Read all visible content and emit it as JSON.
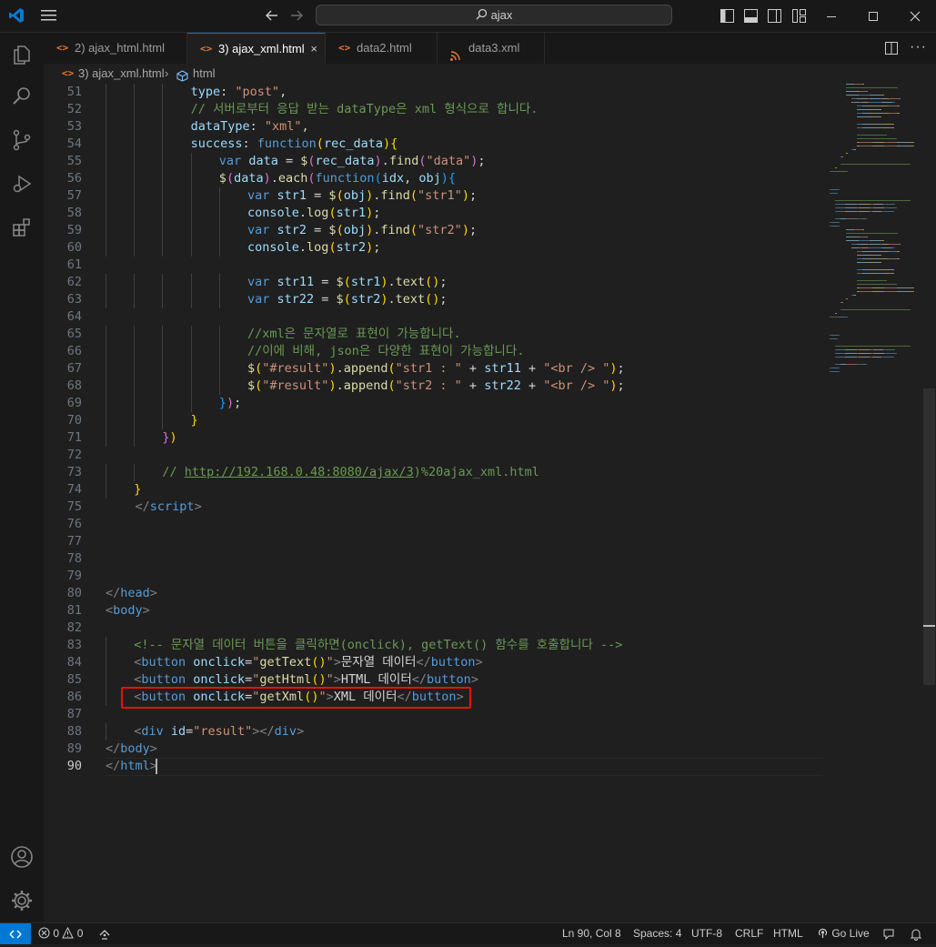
{
  "window": {
    "search": "ajax"
  },
  "tabs": [
    {
      "icon": "<>",
      "label": "2) ajax_html.html",
      "active": false
    },
    {
      "icon": "<>",
      "label": "3) ajax_xml.html",
      "active": true,
      "close": "×"
    },
    {
      "icon": "<>",
      "label": "data2.html",
      "active": false
    },
    {
      "icon": "rss",
      "label": "data3.xml",
      "active": false
    }
  ],
  "breadcrumb": {
    "file": "3) ajax_xml.html",
    "symbol": "html"
  },
  "editor": {
    "current_line": 90,
    "lines": [
      {
        "n": 51,
        "indent": 12,
        "tokens": [
          [
            "v",
            "type"
          ],
          [
            "p",
            ": "
          ],
          [
            "s",
            "\"post\""
          ],
          [
            "p",
            ","
          ]
        ]
      },
      {
        "n": 52,
        "indent": 12,
        "tokens": [
          [
            "c",
            "// 서버로부터 응답 받는 dataType은 xml 형식으로 합니다."
          ]
        ]
      },
      {
        "n": 53,
        "indent": 12,
        "tokens": [
          [
            "v",
            "dataType"
          ],
          [
            "p",
            ": "
          ],
          [
            "s",
            "\"xml\""
          ],
          [
            "p",
            ","
          ]
        ]
      },
      {
        "n": 54,
        "indent": 12,
        "tokens": [
          [
            "v",
            "success"
          ],
          [
            "p",
            ": "
          ],
          [
            "k",
            "function"
          ],
          [
            "y",
            "("
          ],
          [
            "v",
            "rec_data"
          ],
          [
            "y",
            ")"
          ],
          [
            "y",
            "{"
          ]
        ]
      },
      {
        "n": 55,
        "indent": 16,
        "tokens": [
          [
            "k",
            "var "
          ],
          [
            "v",
            "data"
          ],
          [
            "p",
            " = "
          ],
          [
            "f",
            "$"
          ],
          [
            "m",
            "("
          ],
          [
            "v",
            "rec_data"
          ],
          [
            "m",
            ")"
          ],
          [
            "p",
            "."
          ],
          [
            "f",
            "find"
          ],
          [
            "m",
            "("
          ],
          [
            "s",
            "\"data\""
          ],
          [
            "m",
            ")"
          ],
          [
            "p",
            ";"
          ]
        ]
      },
      {
        "n": 56,
        "indent": 16,
        "tokens": [
          [
            "f",
            "$"
          ],
          [
            "m",
            "("
          ],
          [
            "v",
            "data"
          ],
          [
            "m",
            ")"
          ],
          [
            "p",
            "."
          ],
          [
            "f",
            "each"
          ],
          [
            "m",
            "("
          ],
          [
            "k",
            "function"
          ],
          [
            "b",
            "("
          ],
          [
            "v",
            "idx"
          ],
          [
            "p",
            ", "
          ],
          [
            "v",
            "obj"
          ],
          [
            "b",
            ")"
          ],
          [
            "b",
            "{"
          ]
        ]
      },
      {
        "n": 57,
        "indent": 20,
        "tokens": [
          [
            "k",
            "var "
          ],
          [
            "v",
            "str1"
          ],
          [
            "p",
            " = "
          ],
          [
            "f",
            "$"
          ],
          [
            "y",
            "("
          ],
          [
            "v",
            "obj"
          ],
          [
            "y",
            ")"
          ],
          [
            "p",
            "."
          ],
          [
            "f",
            "find"
          ],
          [
            "y",
            "("
          ],
          [
            "s",
            "\"str1\""
          ],
          [
            "y",
            ")"
          ],
          [
            "p",
            ";"
          ]
        ]
      },
      {
        "n": 58,
        "indent": 20,
        "tokens": [
          [
            "v",
            "console"
          ],
          [
            "p",
            "."
          ],
          [
            "f",
            "log"
          ],
          [
            "y",
            "("
          ],
          [
            "v",
            "str1"
          ],
          [
            "y",
            ")"
          ],
          [
            "p",
            ";"
          ]
        ]
      },
      {
        "n": 59,
        "indent": 20,
        "tokens": [
          [
            "k",
            "var "
          ],
          [
            "v",
            "str2"
          ],
          [
            "p",
            " = "
          ],
          [
            "f",
            "$"
          ],
          [
            "y",
            "("
          ],
          [
            "v",
            "obj"
          ],
          [
            "y",
            ")"
          ],
          [
            "p",
            "."
          ],
          [
            "f",
            "find"
          ],
          [
            "y",
            "("
          ],
          [
            "s",
            "\"str2\""
          ],
          [
            "y",
            ")"
          ],
          [
            "p",
            ";"
          ]
        ]
      },
      {
        "n": 60,
        "indent": 20,
        "tokens": [
          [
            "v",
            "console"
          ],
          [
            "p",
            "."
          ],
          [
            "f",
            "log"
          ],
          [
            "y",
            "("
          ],
          [
            "v",
            "str2"
          ],
          [
            "y",
            ")"
          ],
          [
            "p",
            ";"
          ]
        ]
      },
      {
        "n": 61,
        "indent": 0,
        "tokens": []
      },
      {
        "n": 62,
        "indent": 20,
        "tokens": [
          [
            "k",
            "var "
          ],
          [
            "v",
            "str11"
          ],
          [
            "p",
            " = "
          ],
          [
            "f",
            "$"
          ],
          [
            "y",
            "("
          ],
          [
            "v",
            "str1"
          ],
          [
            "y",
            ")"
          ],
          [
            "p",
            "."
          ],
          [
            "f",
            "text"
          ],
          [
            "y",
            "()"
          ],
          [
            "p",
            ";"
          ]
        ]
      },
      {
        "n": 63,
        "indent": 20,
        "tokens": [
          [
            "k",
            "var "
          ],
          [
            "v",
            "str22"
          ],
          [
            "p",
            " = "
          ],
          [
            "f",
            "$"
          ],
          [
            "y",
            "("
          ],
          [
            "v",
            "str2"
          ],
          [
            "y",
            ")"
          ],
          [
            "p",
            "."
          ],
          [
            "f",
            "text"
          ],
          [
            "y",
            "()"
          ],
          [
            "p",
            ";"
          ]
        ]
      },
      {
        "n": 64,
        "indent": 0,
        "tokens": []
      },
      {
        "n": 65,
        "indent": 20,
        "tokens": [
          [
            "c",
            "//xml은 문자열로 표현이 가능합니다."
          ]
        ]
      },
      {
        "n": 66,
        "indent": 20,
        "tokens": [
          [
            "c",
            "//이에 비해, json은 다양한 표현이 가능합니다."
          ]
        ]
      },
      {
        "n": 67,
        "indent": 20,
        "tokens": [
          [
            "f",
            "$"
          ],
          [
            "y",
            "("
          ],
          [
            "s",
            "\"#result\""
          ],
          [
            "y",
            ")"
          ],
          [
            "p",
            "."
          ],
          [
            "f",
            "append"
          ],
          [
            "y",
            "("
          ],
          [
            "s",
            "\"str1 : \""
          ],
          [
            "p",
            " + "
          ],
          [
            "v",
            "str11"
          ],
          [
            "p",
            " + "
          ],
          [
            "s",
            "\"<br /> \""
          ],
          [
            "y",
            ")"
          ],
          [
            "p",
            ";"
          ]
        ]
      },
      {
        "n": 68,
        "indent": 20,
        "tokens": [
          [
            "f",
            "$"
          ],
          [
            "y",
            "("
          ],
          [
            "s",
            "\"#result\""
          ],
          [
            "y",
            ")"
          ],
          [
            "p",
            "."
          ],
          [
            "f",
            "append"
          ],
          [
            "y",
            "("
          ],
          [
            "s",
            "\"str2 : \""
          ],
          [
            "p",
            " + "
          ],
          [
            "v",
            "str22"
          ],
          [
            "p",
            " + "
          ],
          [
            "s",
            "\"<br /> \""
          ],
          [
            "y",
            ")"
          ],
          [
            "p",
            ";"
          ]
        ]
      },
      {
        "n": 69,
        "indent": 16,
        "tokens": [
          [
            "b",
            "}"
          ],
          [
            "m",
            ")"
          ],
          [
            "p",
            ";"
          ]
        ]
      },
      {
        "n": 70,
        "indent": 12,
        "tokens": [
          [
            "y",
            "}"
          ]
        ]
      },
      {
        "n": 71,
        "indent": 8,
        "tokens": [
          [
            "m",
            "}"
          ],
          [
            "y",
            ")"
          ]
        ]
      },
      {
        "n": 72,
        "indent": 0,
        "tokens": []
      },
      {
        "n": 73,
        "indent": 8,
        "tokens": [
          [
            "c",
            "// "
          ],
          [
            "u",
            "http://192.168.0.48:8080/ajax/3"
          ],
          [
            "c",
            ")%20ajax_xml.html"
          ]
        ]
      },
      {
        "n": 74,
        "indent": 4,
        "tokens": [
          [
            "y",
            "}"
          ]
        ]
      },
      {
        "n": 75,
        "indent": 0,
        "tokens": [
          [
            "tag",
            "    </"
          ],
          [
            "t",
            "script"
          ],
          [
            "tag",
            ">"
          ]
        ]
      },
      {
        "n": 76,
        "indent": 0,
        "tokens": []
      },
      {
        "n": 77,
        "indent": 0,
        "tokens": []
      },
      {
        "n": 78,
        "indent": 0,
        "tokens": []
      },
      {
        "n": 79,
        "indent": 0,
        "tokens": []
      },
      {
        "n": 80,
        "indent": 0,
        "tokens": [
          [
            "tag",
            "</"
          ],
          [
            "t",
            "head"
          ],
          [
            "tag",
            ">"
          ]
        ]
      },
      {
        "n": 81,
        "indent": 0,
        "tokens": [
          [
            "tag",
            "<"
          ],
          [
            "t",
            "body"
          ],
          [
            "tag",
            ">"
          ]
        ]
      },
      {
        "n": 82,
        "indent": 0,
        "tokens": []
      },
      {
        "n": 83,
        "indent": 4,
        "tokens": [
          [
            "c",
            "<!-- 문자열 데이터 버튼을 클릭하면(onclick), getText() 함수를 호출합니다 -->"
          ]
        ]
      },
      {
        "n": 84,
        "indent": 4,
        "tokens": [
          [
            "tag",
            "<"
          ],
          [
            "t",
            "button"
          ],
          [
            "v",
            " onclick"
          ],
          [
            "p",
            "="
          ],
          [
            "s",
            "\""
          ],
          [
            "f",
            "getText"
          ],
          [
            "y",
            "()"
          ],
          [
            "s",
            "\""
          ],
          [
            "tag",
            ">"
          ],
          [
            "pl",
            "문자열 데이터"
          ],
          [
            "tag",
            "</"
          ],
          [
            "t",
            "button"
          ],
          [
            "tag",
            ">"
          ]
        ]
      },
      {
        "n": 85,
        "indent": 4,
        "tokens": [
          [
            "tag",
            "<"
          ],
          [
            "t",
            "button"
          ],
          [
            "v",
            " onclick"
          ],
          [
            "p",
            "="
          ],
          [
            "s",
            "\""
          ],
          [
            "f",
            "getHtml"
          ],
          [
            "y",
            "()"
          ],
          [
            "s",
            "\""
          ],
          [
            "tag",
            ">"
          ],
          [
            "pl",
            "HTML 데이터"
          ],
          [
            "tag",
            "</"
          ],
          [
            "t",
            "button"
          ],
          [
            "tag",
            ">"
          ]
        ]
      },
      {
        "n": 86,
        "indent": 4,
        "tokens": [
          [
            "tag",
            "<"
          ],
          [
            "t",
            "button"
          ],
          [
            "v",
            " onclick"
          ],
          [
            "p",
            "="
          ],
          [
            "s",
            "\""
          ],
          [
            "f",
            "getXml"
          ],
          [
            "y",
            "()"
          ],
          [
            "s",
            "\""
          ],
          [
            "tag",
            ">"
          ],
          [
            "pl",
            "XML 데이터"
          ],
          [
            "tag",
            "</"
          ],
          [
            "t",
            "button"
          ],
          [
            "tag",
            ">"
          ]
        ]
      },
      {
        "n": 87,
        "indent": 0,
        "tokens": []
      },
      {
        "n": 88,
        "indent": 4,
        "tokens": [
          [
            "tag",
            "<"
          ],
          [
            "t",
            "div"
          ],
          [
            "v",
            " id"
          ],
          [
            "p",
            "="
          ],
          [
            "s",
            "\"result\""
          ],
          [
            "tag",
            "></"
          ],
          [
            "t",
            "div"
          ],
          [
            "tag",
            ">"
          ]
        ]
      },
      {
        "n": 89,
        "indent": 0,
        "tokens": [
          [
            "tag",
            "</"
          ],
          [
            "t",
            "body"
          ],
          [
            "tag",
            ">"
          ]
        ]
      },
      {
        "n": 90,
        "indent": 0,
        "tokens": [
          [
            "tag",
            "</"
          ],
          [
            "t",
            "html"
          ],
          [
            "tag",
            ">"
          ]
        ]
      }
    ]
  },
  "statusbar": {
    "errors": "0",
    "warnings": "0",
    "position": "Ln 90, Col 8",
    "spaces": "Spaces: 4",
    "encoding": "UTF-8",
    "eol": "CRLF",
    "language": "HTML",
    "golive": "Go Live"
  },
  "colors": {
    "accent": "#0078d4",
    "highlight": "#e51400"
  }
}
